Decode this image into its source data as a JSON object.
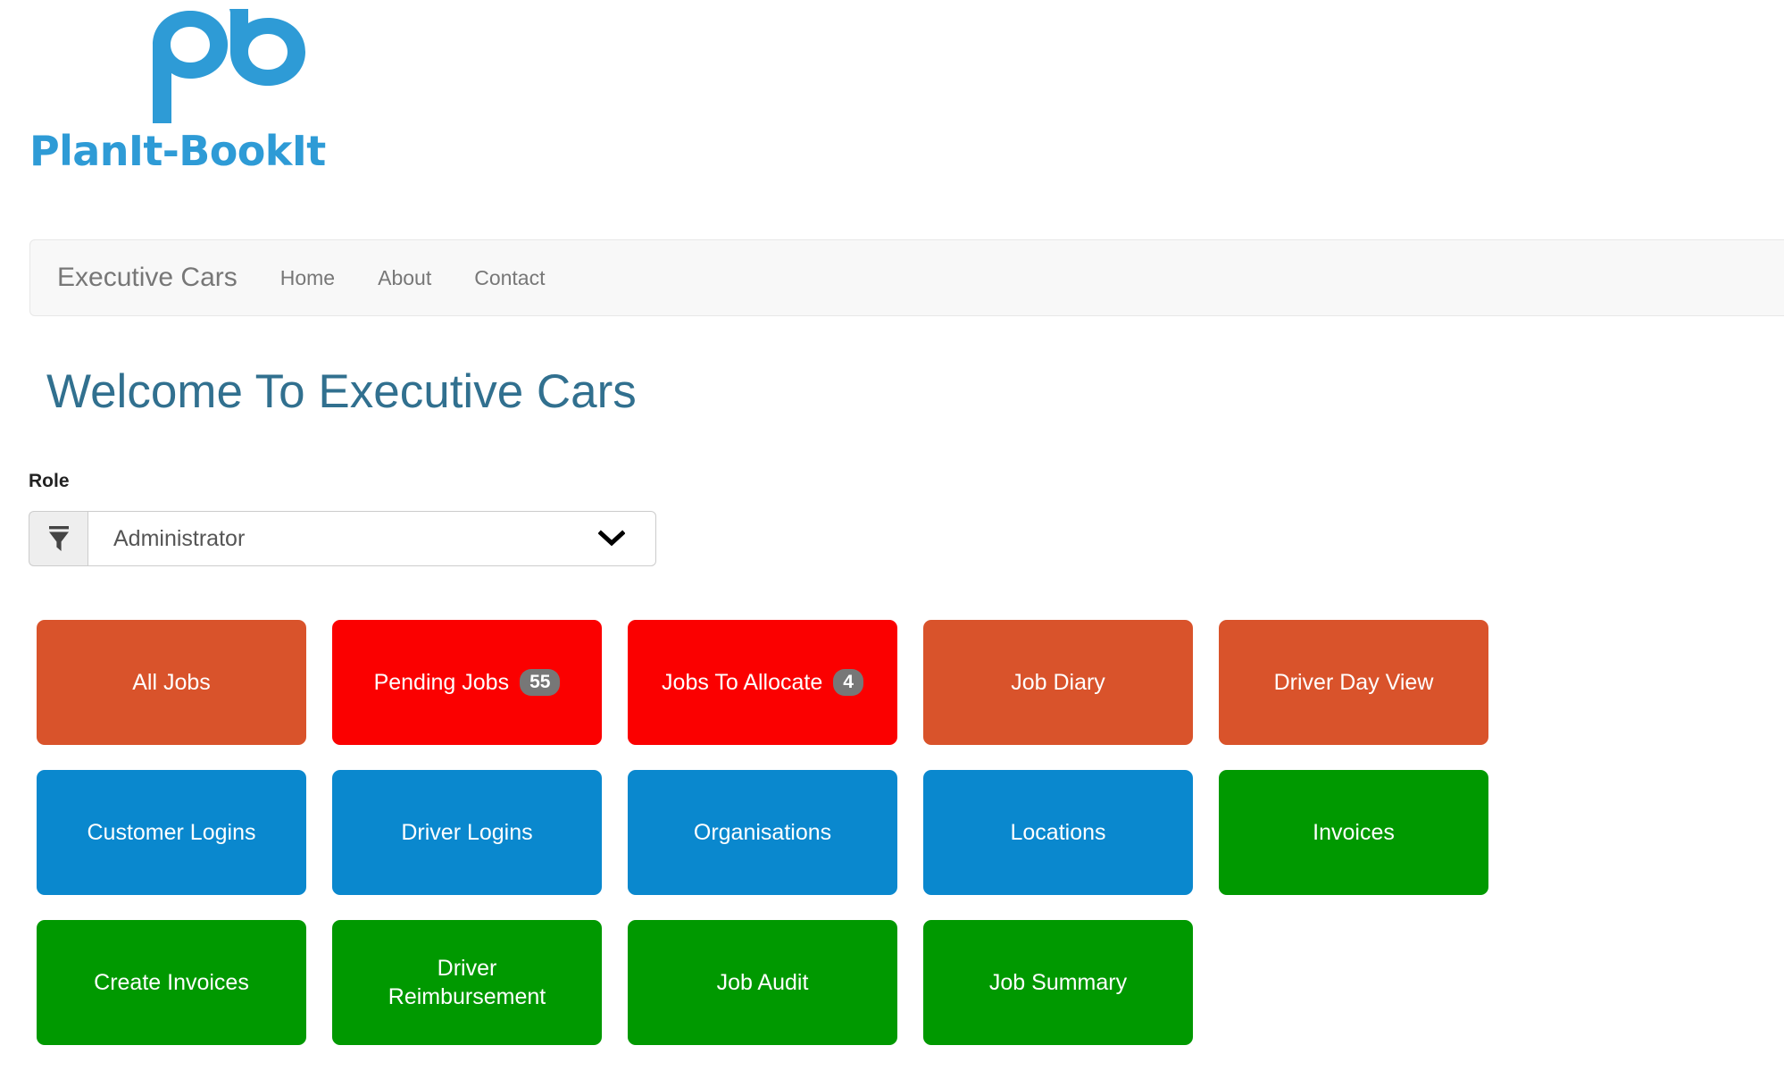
{
  "logo": {
    "wordmark": "PlanIt-BookIt",
    "mark_icon": "pb-monogram-icon",
    "brand_color": "#2e9bd6"
  },
  "navbar": {
    "brand": "Executive Cars",
    "links": [
      {
        "label": "Home"
      },
      {
        "label": "About"
      },
      {
        "label": "Contact"
      }
    ]
  },
  "main": {
    "page_title": "Welcome To Executive Cars",
    "title_color": "#31708f"
  },
  "role_field": {
    "label": "Role",
    "filter_icon": "funnel-filter-icon",
    "selected": "Administrator",
    "chevron_icon": "chevron-down-icon"
  },
  "colors": {
    "orange": "#d9532b",
    "red": "#fb0000",
    "blue": "#0a88ce",
    "green": "#009900",
    "badge_gray": "#777777"
  },
  "tiles": [
    {
      "label": "All Jobs",
      "color": "#d9532b",
      "badge": null
    },
    {
      "label": "Pending Jobs",
      "color": "#fb0000",
      "badge": "55"
    },
    {
      "label": "Jobs To Allocate",
      "color": "#fb0000",
      "badge": "4"
    },
    {
      "label": "Job Diary",
      "color": "#d9532b",
      "badge": null
    },
    {
      "label": "Driver Day View",
      "color": "#d9532b",
      "badge": null
    },
    {
      "label": "Customer Logins",
      "color": "#0a88ce",
      "badge": null
    },
    {
      "label": "Driver Logins",
      "color": "#0a88ce",
      "badge": null
    },
    {
      "label": "Organisations",
      "color": "#0a88ce",
      "badge": null
    },
    {
      "label": "Locations",
      "color": "#0a88ce",
      "badge": null
    },
    {
      "label": "Invoices",
      "color": "#009900",
      "badge": null
    },
    {
      "label": "Create Invoices",
      "color": "#009900",
      "badge": null
    },
    {
      "label": "Driver\nReimbursement",
      "color": "#009900",
      "badge": null
    },
    {
      "label": "Job Audit",
      "color": "#009900",
      "badge": null
    },
    {
      "label": "Job Summary",
      "color": "#009900",
      "badge": null
    }
  ]
}
